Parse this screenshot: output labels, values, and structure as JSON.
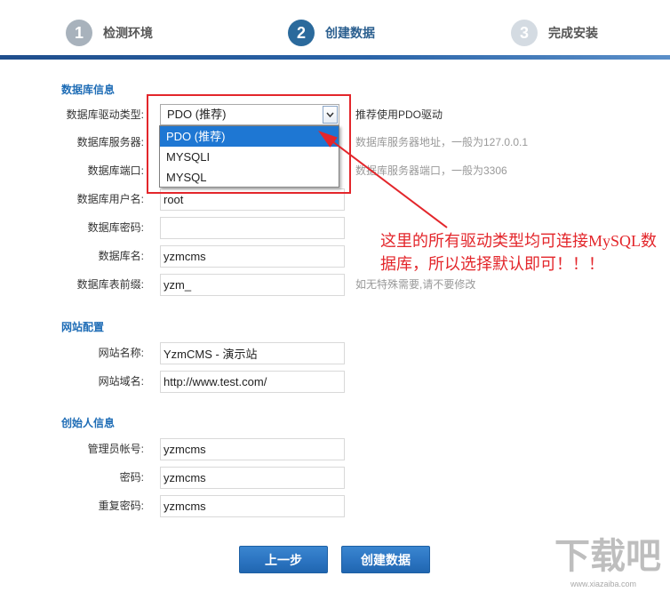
{
  "steps": [
    {
      "number": "1",
      "label": "检测环境"
    },
    {
      "number": "2",
      "label": "创建数据"
    },
    {
      "number": "3",
      "label": "完成安装"
    }
  ],
  "database": {
    "title": "数据库信息",
    "driver": {
      "label": "数据库驱动类型:",
      "selected": "PDO (推荐)",
      "hint": "推荐使用PDO驱动",
      "options": [
        "PDO (推荐)",
        "MYSQLI",
        "MYSQL"
      ]
    },
    "server": {
      "label": "数据库服务器:",
      "hint": "数据库服务器地址，一般为127.0.0.1"
    },
    "port": {
      "label": "数据库端口:",
      "hint": "数据库服务器端口，一般为3306"
    },
    "username": {
      "label": "数据库用户名:",
      "value": "root"
    },
    "password": {
      "label": "数据库密码:",
      "value": ""
    },
    "name": {
      "label": "数据库名:",
      "value": "yzmcms"
    },
    "prefix": {
      "label": "数据库表前缀:",
      "value": "yzm_",
      "hint": "如无特殊需要,请不要修改"
    }
  },
  "site": {
    "title": "网站配置",
    "name": {
      "label": "网站名称:",
      "value": "YzmCMS - 演示站"
    },
    "domain": {
      "label": "网站域名:",
      "value": "http://www.test.com/"
    }
  },
  "founder": {
    "title": "创始人信息",
    "account": {
      "label": "管理员帐号:",
      "value": "yzmcms"
    },
    "password": {
      "label": "密码:",
      "value": "yzmcms"
    },
    "repeat_password": {
      "label": "重复密码:",
      "value": "yzmcms"
    }
  },
  "buttons": {
    "prev": "上一步",
    "create": "创建数据"
  },
  "annotation": {
    "lines": [
      "这里的所有驱动类型均可连接MySQL数",
      "据库，所以选择默认即可！！！"
    ]
  },
  "watermark": {
    "logo_text": "下载吧",
    "url": "www.xiazaiba.com"
  },
  "colors": {
    "accent": "#2b6a9c",
    "section_title": "#1f6db6",
    "annotation": "#e3262b",
    "button": "#2a72bf",
    "option_highlight": "#1e77d3"
  }
}
